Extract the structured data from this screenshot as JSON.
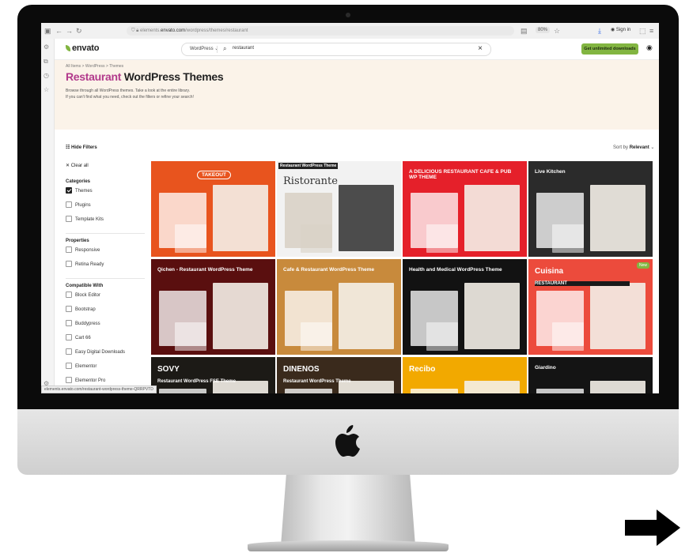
{
  "browser": {
    "url_prefix": "elements.",
    "url_domain": "envato.com",
    "url_path": "/wordpress/themes/restaurant",
    "zoom": "80%",
    "sign_in": "Sign in",
    "status_url": "elements.envato.com/restaurant-wordpress-theme-QRRPVTD"
  },
  "header": {
    "logo": "envato",
    "search_category": "WordPress",
    "search_query": "restaurant",
    "cta": "Get unlimited downloads"
  },
  "hero": {
    "breadcrumb": "All Items  >  WordPress  >  Themes",
    "title_accent": "Restaurant",
    "title_rest": " WordPress Themes",
    "sub1": "Browse through all WordPress themes. Take a look at the entire library.",
    "sub2": "If you can't find what you need, check out the filters or refine your search!"
  },
  "toolbar": {
    "hide_filters": "Hide Filters",
    "sort_prefix": "Sort by",
    "sort_value": "Relevant"
  },
  "filters": {
    "clear_all": "Clear all",
    "categories_title": "Categories",
    "categories": [
      {
        "label": "Themes",
        "checked": true
      },
      {
        "label": "Plugins",
        "checked": false
      },
      {
        "label": "Template Kits",
        "checked": false
      }
    ],
    "properties_title": "Properties",
    "properties": [
      {
        "label": "Responsive"
      },
      {
        "label": "Retina Ready"
      }
    ],
    "compatible_title": "Compatible With",
    "compatible": [
      {
        "label": "Block Editor"
      },
      {
        "label": "Bootstrap"
      },
      {
        "label": "Buddypress"
      },
      {
        "label": "Cart 66"
      },
      {
        "label": "Easy Digital Downloads"
      },
      {
        "label": "Elementor"
      },
      {
        "label": "Elementor Pro"
      }
    ]
  },
  "cards": [
    {
      "bg": "#e8541e",
      "text": "TAKEOUT"
    },
    {
      "bg": "#f2f2f2",
      "text": "Ristorante",
      "tag": "Restaurant WordPress Theme"
    },
    {
      "bg": "#e5202a",
      "text": "A DELICIOUS RESTAURANT CAFE & PUB WP THEME"
    },
    {
      "bg": "#2b2b2b",
      "text": "Live Kitchen"
    },
    {
      "bg": "#5a0f0f",
      "text": "Qichen - Restaurant WordPress Theme"
    },
    {
      "bg": "#c88a3c",
      "text": "Cafe & Restaurant WordPress Theme"
    },
    {
      "bg": "#121212",
      "text": "Health and Medical WordPress Theme"
    },
    {
      "bg": "#ec4b3c",
      "text": "Cuisina",
      "badge": "New",
      "sub": "RESTAURANT"
    },
    {
      "bg": "#1c1a16",
      "text": "SOVY",
      "sub": "Restaurant WordPress FSE Theme"
    },
    {
      "bg": "#3a2a1c",
      "text": "DINENOS",
      "sub": "Restaurant WordPress Theme"
    },
    {
      "bg": "#f2a900",
      "text": "Recibo"
    },
    {
      "bg": "#141414",
      "text": "Giardino"
    }
  ]
}
